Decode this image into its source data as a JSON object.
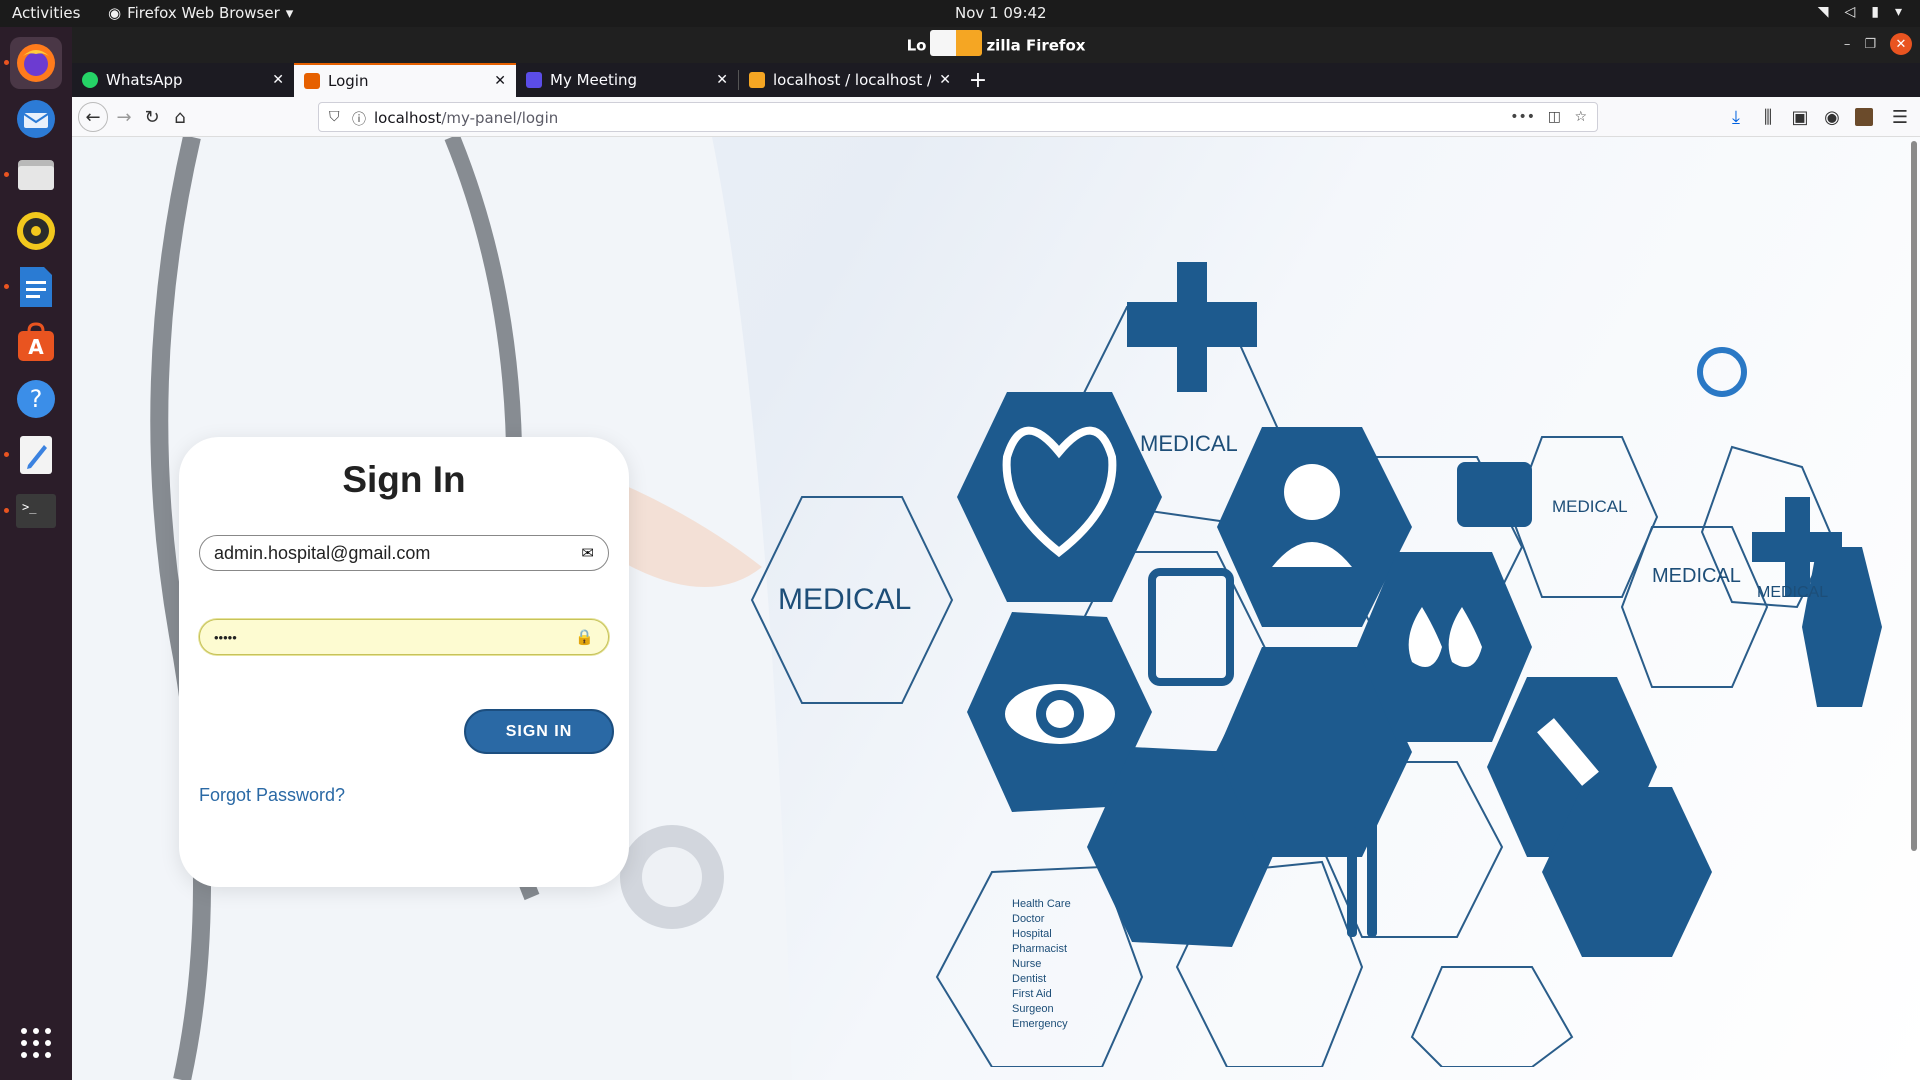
{
  "os": {
    "activities": "Activities",
    "app_menu": "Firefox Web Browser",
    "clock": "Nov 1  09:42"
  },
  "dock": {
    "items": [
      {
        "name": "Firefox",
        "icon": "firefox-icon",
        "color": "#e66000",
        "running": true
      },
      {
        "name": "Thunderbird",
        "icon": "thunderbird-icon",
        "color": "#2c7bd6",
        "running": false
      },
      {
        "name": "Files",
        "icon": "files-icon",
        "color": "#8e8e8e",
        "running": true
      },
      {
        "name": "Rhythmbox",
        "icon": "rhythmbox-icon",
        "color": "#f2c81d",
        "running": false
      },
      {
        "name": "LibreOffice Writer",
        "icon": "writer-icon",
        "color": "#2a7bd3",
        "running": true
      },
      {
        "name": "Ubuntu Software",
        "icon": "software-icon",
        "color": "#e95420",
        "running": false
      },
      {
        "name": "Help",
        "icon": "help-icon",
        "color": "#3b8ee8",
        "running": false
      },
      {
        "name": "Text Editor",
        "icon": "text-editor-icon",
        "color": "#3b82e0",
        "running": true
      },
      {
        "name": "Terminal",
        "icon": "terminal-icon",
        "color": "#3a3a3a",
        "running": true
      }
    ],
    "show_apps_icon": "grid-icon"
  },
  "window": {
    "title_left": "Lo",
    "title_right": "zilla Firefox"
  },
  "tabs": [
    {
      "title": "WhatsApp",
      "favicon": "whatsapp-icon",
      "color": "#25d366",
      "active": false
    },
    {
      "title": "Login",
      "favicon": "login-favicon-icon",
      "color": "#e66000",
      "active": true
    },
    {
      "title": "My Meeting",
      "favicon": "meeting-icon",
      "color": "#5b4de8",
      "active": false
    },
    {
      "title": "localhost / localhost / Ho",
      "favicon": "phpmyadmin-icon",
      "color": "#f5a623",
      "active": false
    }
  ],
  "navbar": {
    "url_host": "localhost",
    "url_path": "/my-panel/login"
  },
  "login": {
    "title": "Sign In",
    "email_value": "admin.hospital@gmail.com",
    "password_value": "•••••",
    "submit_label": "SIGN IN",
    "forgot_label": "Forgot Password?"
  },
  "background": {
    "labels": [
      "MEDICAL",
      "MEDICAL",
      "MEDICAL",
      "MEDICAL",
      "MEDICAL"
    ],
    "list_text": [
      "Health Care",
      "Doctor",
      "Hospital",
      "Pharmacist",
      "Nurse",
      "Dentist",
      "First Aid",
      "Surgeon",
      "Emergency"
    ],
    "accent_color": "#1d5a8e"
  }
}
